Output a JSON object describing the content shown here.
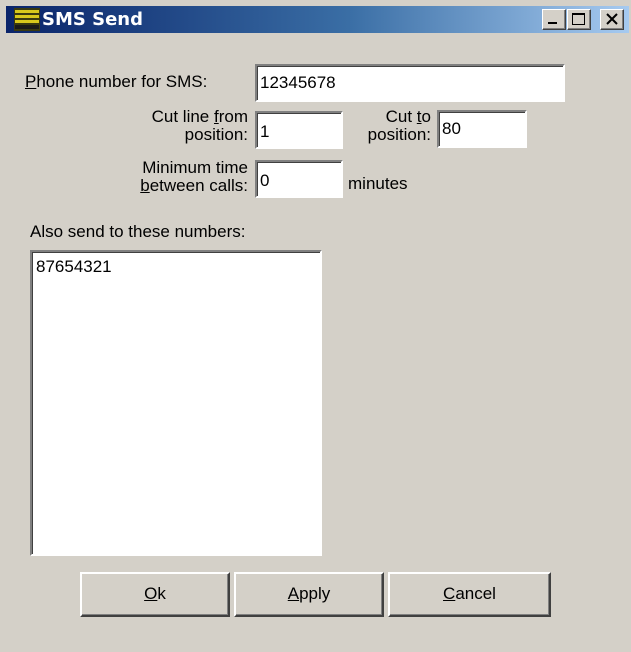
{
  "window": {
    "title": "SMS Send",
    "icon": "app-logo-icon",
    "controls": [
      "minimize-icon",
      "maximize-icon",
      "close-icon"
    ]
  },
  "form": {
    "phone": {
      "label_hotkey": "P",
      "label_rest": "hone number for SMS:",
      "value": "12345678"
    },
    "cut_from": {
      "label_line1_pre": "Cut line ",
      "label_line1_hotkey": "f",
      "label_line1_post": "rom",
      "label_line2": "position:",
      "value": "1"
    },
    "cut_to": {
      "label_line1_pre": "Cut ",
      "label_line1_hotkey": "t",
      "label_line1_post": "o",
      "label_line2": "position:",
      "value": "80"
    },
    "min_time": {
      "label_line1": "Minimum time",
      "label_line2_hotkey": "b",
      "label_line2_rest": "etween calls:",
      "value": "0",
      "unit": "minutes"
    },
    "also_send": {
      "label": "Also send to these numbers:",
      "items": [
        "87654321"
      ]
    }
  },
  "buttons": {
    "ok": {
      "hotkey": "O",
      "rest": "k"
    },
    "apply": {
      "hotkey": "A",
      "rest": "pply"
    },
    "cancel": {
      "hotkey": "C",
      "rest": "ancel"
    }
  }
}
